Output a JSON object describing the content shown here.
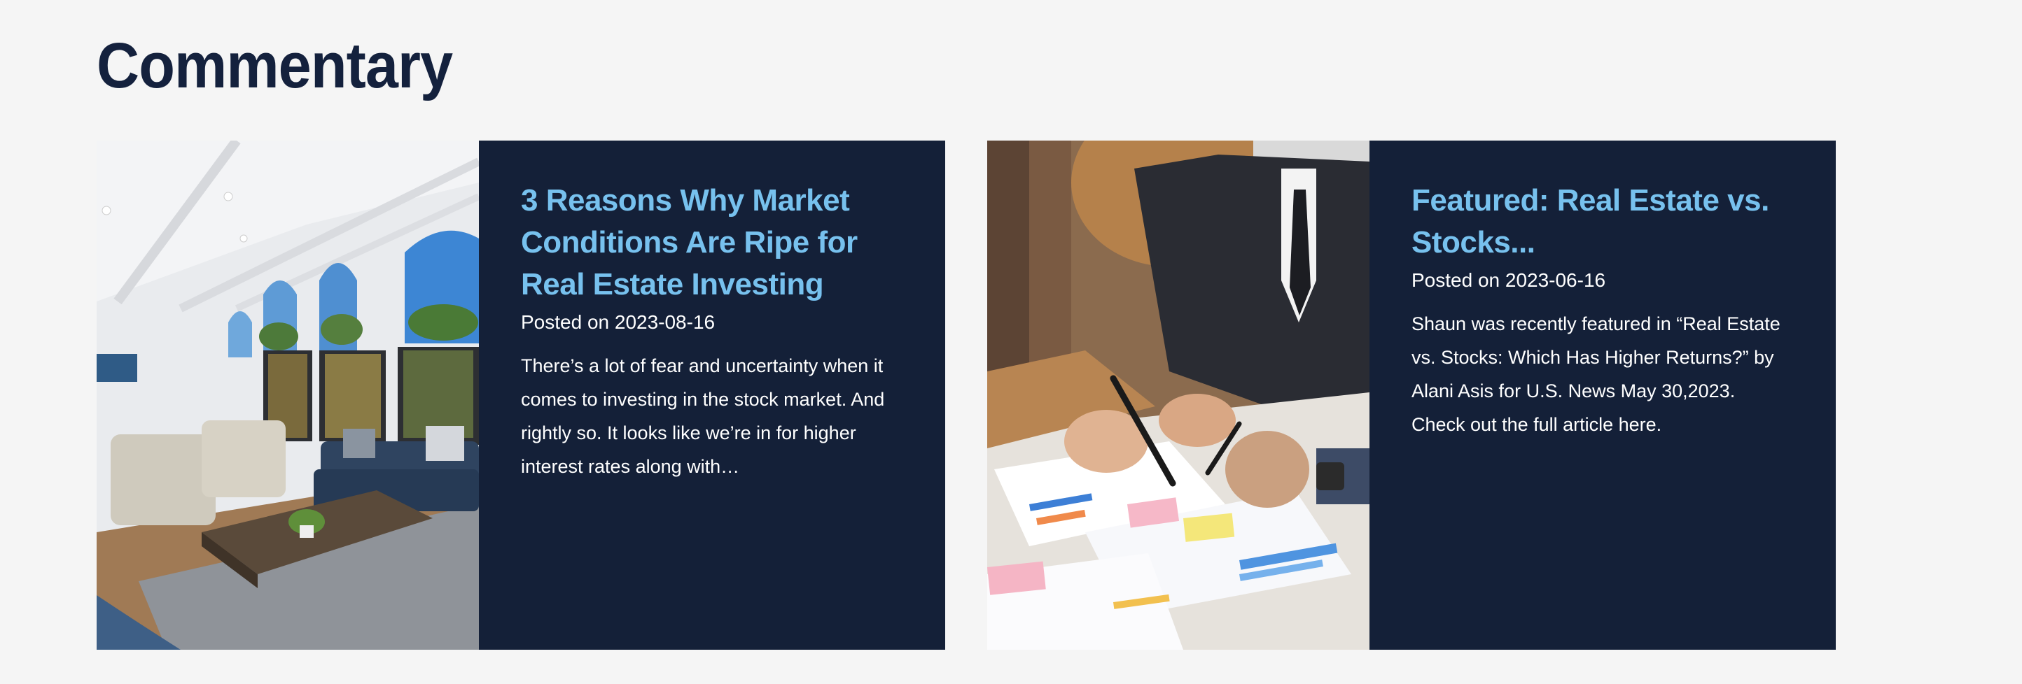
{
  "section": {
    "title": "Commentary"
  },
  "posts": [
    {
      "title": "3 Reasons Why Market Conditions Are Ripe for Real Estate Investing",
      "date": "Posted on 2023-08-16",
      "excerpt": "There’s a lot of fear and uncertainty when it comes to investing in the stock market. And rightly so.  It looks like we’re in for higher interest rates along with…",
      "image_subject": "living-room-interior"
    },
    {
      "title": "Featured: Real Estate vs. Stocks...",
      "date": "Posted on 2023-06-16",
      "excerpt": "Shaun was recently featured in “Real Estate vs. Stocks: Which Has Higher Returns?” by Alani Asis for U.S. News May 30,2023. Check out the full article here.",
      "image_subject": "business-charts-meeting"
    }
  ],
  "colors": {
    "page_background": "#f5f5f5",
    "heading": "#14213d",
    "card_background": "#142038",
    "post_title": "#77c1ee",
    "post_text": "#ffffff"
  }
}
